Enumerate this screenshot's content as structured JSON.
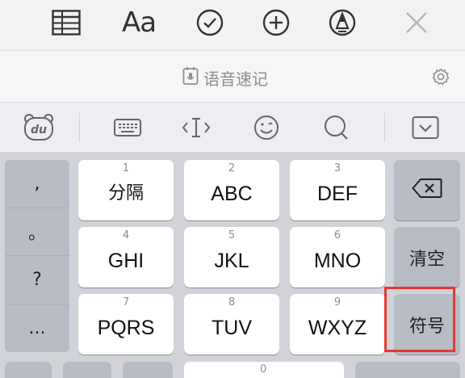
{
  "notes_toolbar": {
    "icons": [
      "table-icon",
      "font-format-icon",
      "checklist-icon",
      "add-icon",
      "markup-pen-icon",
      "close-icon"
    ],
    "font_label": "Aa"
  },
  "voice_bar": {
    "label": "语音速记",
    "icon": "voice-memo-icon",
    "settings_icon": "gear-icon"
  },
  "ime_bar": {
    "icons": [
      "du-logo-icon",
      "keyboard-icon",
      "cursor-icon",
      "emoji-icon",
      "search-icon",
      "collapse-keyboard-icon"
    ]
  },
  "keyboard": {
    "punctuation": [
      ",",
      "。",
      "?",
      "..."
    ],
    "keys": [
      {
        "num": "1",
        "label": "分隔"
      },
      {
        "num": "2",
        "label": "ABC"
      },
      {
        "num": "3",
        "label": "DEF"
      },
      {
        "num": "4",
        "label": "GHI"
      },
      {
        "num": "5",
        "label": "JKL"
      },
      {
        "num": "6",
        "label": "MNO"
      },
      {
        "num": "7",
        "label": "PQRS"
      },
      {
        "num": "8",
        "label": "TUV"
      },
      {
        "num": "9",
        "label": "WXYZ"
      }
    ],
    "function_keys": {
      "delete_icon": "backspace-icon",
      "clear": "清空",
      "symbols": "符号"
    },
    "bottom_num": "0"
  },
  "colors": {
    "keyboard_bg": "#d1d3d9",
    "function_key_bg": "#b8bcc4",
    "highlight": "#e53935"
  }
}
